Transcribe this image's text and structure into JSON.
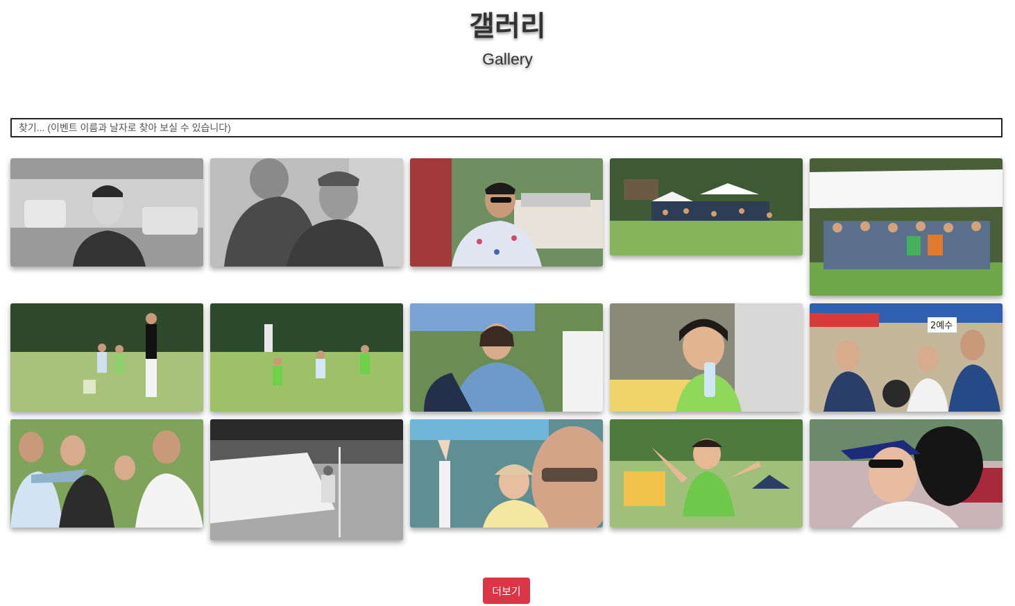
{
  "header": {
    "title_ko": "갤러리",
    "title_en": "Gallery"
  },
  "search": {
    "placeholder": "찾기... (이벤트 이름과 날자로 찾아 보실 수 있습니다)",
    "value": ""
  },
  "gallery": {
    "photos": [
      {
        "scene": "bw-portrait-man-glasses"
      },
      {
        "scene": "bw-men-talking"
      },
      {
        "scene": "man-sunglasses-picnic-table"
      },
      {
        "scene": "picnic-tents-park-crowd"
      },
      {
        "scene": "group-under-white-tent"
      },
      {
        "scene": "woman-children-on-lawn"
      },
      {
        "scene": "children-playing-field"
      },
      {
        "scene": "woman-denim-jacket-smiling"
      },
      {
        "scene": "girl-drinking-water"
      },
      {
        "scene": "people-at-booth-2예수"
      },
      {
        "scene": "men-tug-of-war"
      },
      {
        "scene": "bw-child-with-kite"
      },
      {
        "scene": "woman-peace-sign-hat"
      },
      {
        "scene": "toddler-green-shirt-running"
      },
      {
        "scene": "woman-visor-laughing"
      }
    ]
  },
  "load_more": {
    "label": "더보기"
  },
  "colors": {
    "button": "#dc3545",
    "text": "#333333"
  }
}
